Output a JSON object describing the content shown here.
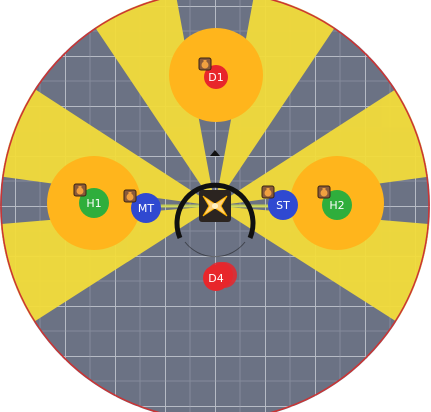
{
  "arena": {
    "floor_color": "#6b7284",
    "grid_color": "#c9cdd6",
    "rim_color": "#cc3333"
  },
  "hazards": {
    "cone_color": "#f3dc3a",
    "aoe_color": "#ffb51c"
  },
  "boss": {
    "name": "boss-marker",
    "glyph": "✦"
  },
  "players": [
    {
      "id": "D1",
      "label": "D1",
      "role": "dps",
      "color": "#e8262b",
      "debuff": true
    },
    {
      "id": "H1",
      "label": "H1",
      "role": "healer",
      "color": "#2fae3c",
      "debuff": true
    },
    {
      "id": "MT",
      "label": "MT",
      "role": "tank",
      "color": "#2f49d1",
      "debuff": true
    },
    {
      "id": "ST",
      "label": "ST",
      "role": "tank",
      "color": "#2f49d1",
      "debuff": true
    },
    {
      "id": "H2",
      "label": "H2",
      "role": "healer",
      "color": "#2fae3c",
      "debuff": true
    },
    {
      "id": "D4",
      "label": "D4",
      "role": "dps",
      "color": "#e8262b",
      "debuff": false
    }
  ],
  "debuff_icon": "bag-debuff-icon"
}
